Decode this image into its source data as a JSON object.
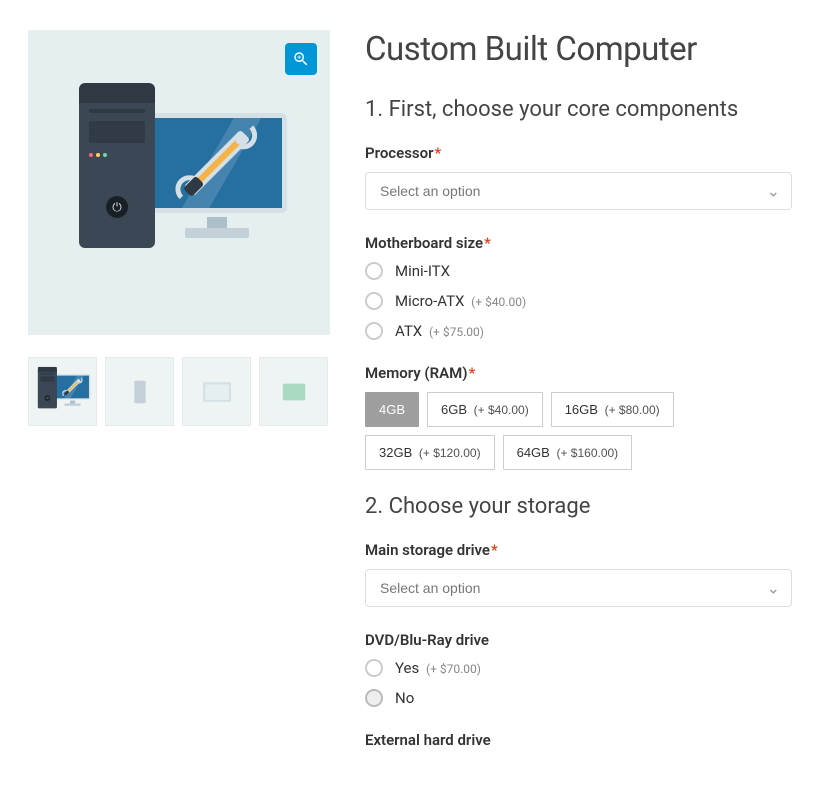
{
  "title": "Custom Built Computer",
  "section1": {
    "heading": "1. First, choose your core components",
    "processor": {
      "label": "Processor",
      "required": true,
      "placeholder": "Select an option"
    },
    "motherboard": {
      "label": "Motherboard size",
      "required": true,
      "options": [
        {
          "label": "Mini-ITX",
          "price": ""
        },
        {
          "label": "Micro-ATX",
          "price": "(+ $40.00)"
        },
        {
          "label": "ATX",
          "price": "(+ $75.00)"
        }
      ]
    },
    "memory": {
      "label": "Memory (RAM)",
      "required": true,
      "options": [
        {
          "label": "4GB",
          "price": "",
          "selected": true
        },
        {
          "label": "6GB",
          "price": "(+ $40.00)"
        },
        {
          "label": "16GB",
          "price": "(+ $80.00)"
        },
        {
          "label": "32GB",
          "price": "(+ $120.00)"
        },
        {
          "label": "64GB",
          "price": "(+ $160.00)"
        }
      ]
    }
  },
  "section2": {
    "heading": "2. Choose your storage",
    "mainStorage": {
      "label": "Main storage drive",
      "required": true,
      "placeholder": "Select an option"
    },
    "optical": {
      "label": "DVD/Blu-Ray drive",
      "options": [
        {
          "label": "Yes",
          "price": "(+ $70.00)"
        },
        {
          "label": "No",
          "price": "",
          "selected": true
        }
      ]
    },
    "external": {
      "label": "External hard drive"
    }
  }
}
